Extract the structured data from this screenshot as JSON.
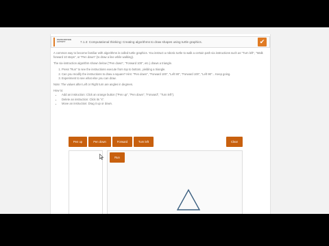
{
  "activity": {
    "tag_line1": "PARTICIPATION",
    "tag_line2": "ACTIVITY",
    "title": "7.1.3: Computational thinking: Creating algorithms to draw shapes using turtle graphics."
  },
  "intro": "A common way to become familiar with algorithms is called turtle graphics. You instruct a robotic turtle to walk a certain path via instructions such as \"Turn left\", \"Walk forward 10 steps\", or \"Pen down\" (to draw a line while walking).",
  "instr_intro": "The six-instruction algorithm shown below (\"Pen down\", \"Forward 100\", etc.) draws a triangle.",
  "steps": [
    "Press \"Run\" to see the instructions execute from top to bottom, yielding a triangle.",
    "Can you modify the instructions to draw a square? Hint: \"Pen down\", \"Forward 100\", \"Left 90\", \"Forward 100\", \"Left 90\"... Keep going.",
    "Experiment to see what else you can draw."
  ],
  "note": "Note: The values after Left or Right turn are angles in degrees.",
  "howto_label": "How to:",
  "howto": [
    "Add an instruction: Click an orange button (\"Pen up\", \"Pen down\", \"Forward\", \"Turn left\").",
    "Delete an instruction: Click its \"x\".",
    "Move an instruction: Drag it up or down."
  ],
  "buttons": {
    "pen_up": "Pen up",
    "pen_down": "Pen down",
    "forward": "Forward",
    "turn_left": "Turn left",
    "clear": "Clear",
    "run": "Run"
  },
  "colors": {
    "accent": "#c8600e",
    "check": "#e07b24",
    "shape": "#3a5f80"
  },
  "icons": {
    "check": "check-icon",
    "cursor": "cursor-icon"
  }
}
